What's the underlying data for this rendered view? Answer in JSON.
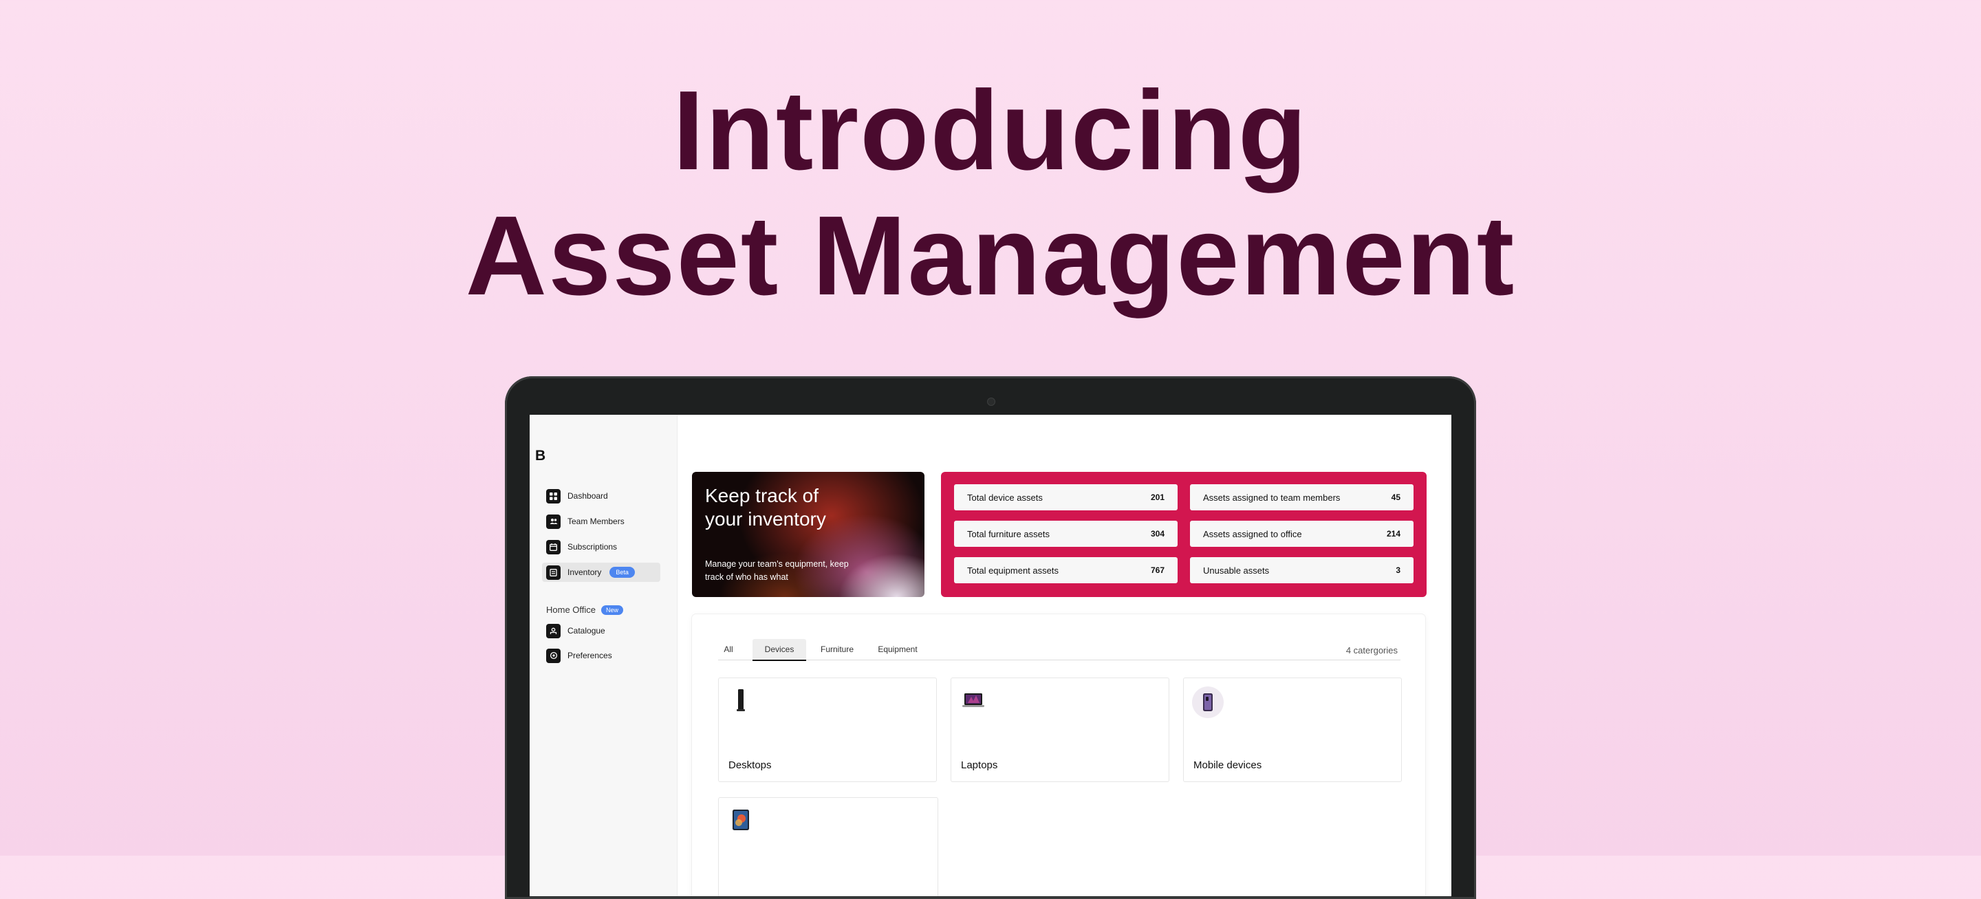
{
  "headline": {
    "line1": "Introducing",
    "line2": "Asset Management"
  },
  "app": {
    "brand": "B",
    "sidebar": {
      "items": [
        {
          "label": "Dashboard",
          "icon": "dashboard-icon"
        },
        {
          "label": "Team Members",
          "icon": "team-icon"
        },
        {
          "label": "Subscriptions",
          "icon": "subscriptions-icon"
        },
        {
          "label": "Inventory",
          "icon": "inventory-icon",
          "badge": "Beta",
          "active": true
        }
      ],
      "section": {
        "label": "Home Office",
        "badge": "New"
      },
      "section_items": [
        {
          "label": "Catalogue",
          "icon": "catalogue-icon"
        },
        {
          "label": "Preferences",
          "icon": "preferences-icon"
        }
      ]
    },
    "hero": {
      "title": "Keep track of your inventory",
      "subtitle": "Manage your team's equipment, keep track of who has what"
    },
    "stats": [
      {
        "label": "Total device assets",
        "value": "201"
      },
      {
        "label": "Assets assigned to team members",
        "value": "45"
      },
      {
        "label": "Total furniture assets",
        "value": "304"
      },
      {
        "label": "Assets assigned to office",
        "value": "214"
      },
      {
        "label": "Total equipment assets",
        "value": "767"
      },
      {
        "label": "Unusable assets",
        "value": "3"
      }
    ],
    "tabs": [
      {
        "label": "All"
      },
      {
        "label": "Devices",
        "active": true
      },
      {
        "label": "Furniture"
      },
      {
        "label": "Equipment"
      }
    ],
    "category_count": "4 catergories",
    "categories": [
      {
        "label": "Desktops",
        "icon": "desktop-tower-icon"
      },
      {
        "label": "Laptops",
        "icon": "laptop-icon"
      },
      {
        "label": "Mobile devices",
        "icon": "phone-icon"
      },
      {
        "label": "",
        "icon": "tablet-icon"
      }
    ],
    "colors": {
      "stats_bg": "#d2164f",
      "badge_blue": "#4d86f0",
      "headline": "#4a0a2e",
      "page_bg": "#fcdff0"
    }
  }
}
